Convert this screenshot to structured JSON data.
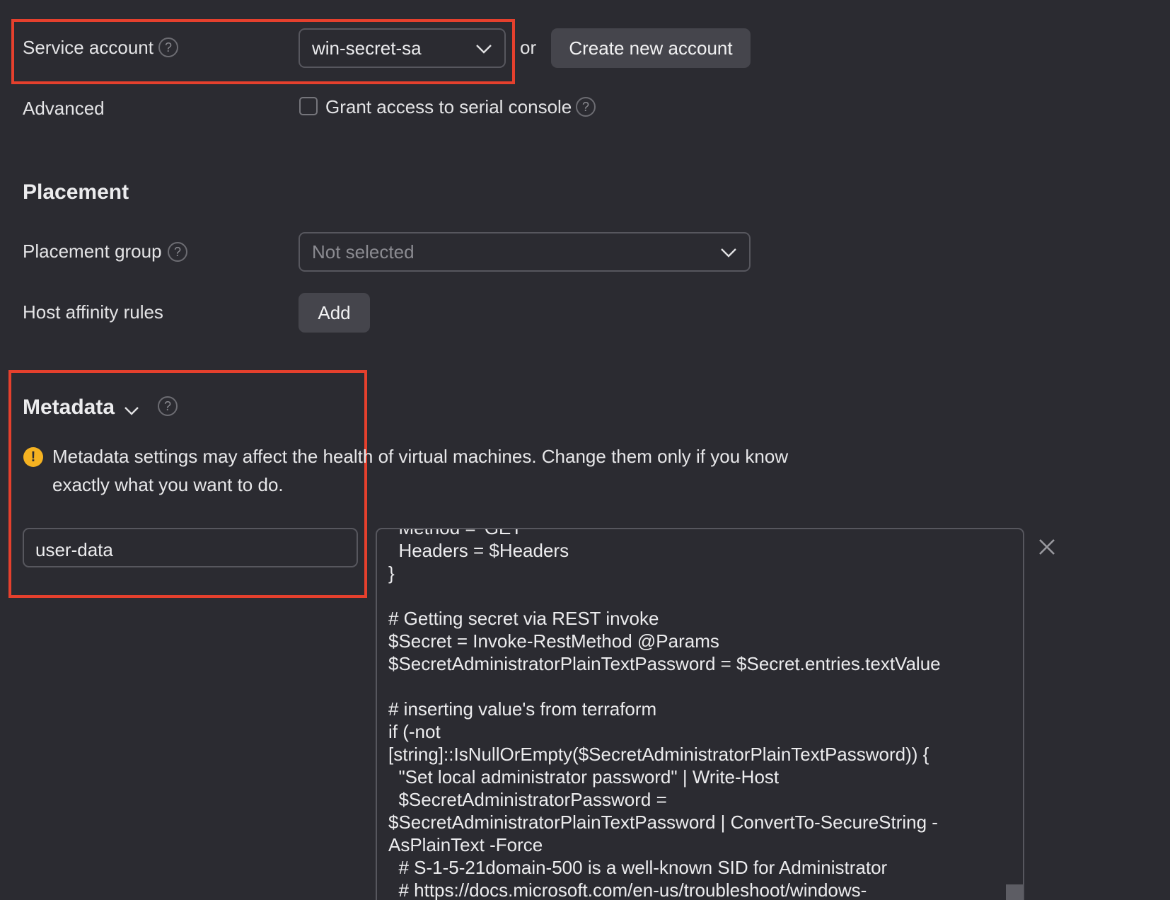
{
  "service_account": {
    "label": "Service account",
    "help": "?",
    "selected": "win-secret-sa",
    "or_text": "or",
    "create_button": "Create new account"
  },
  "advanced": {
    "label": "Advanced",
    "serial_console_label": "Grant access to serial console",
    "serial_console_checked": false,
    "help": "?"
  },
  "placement": {
    "title": "Placement",
    "group_label": "Placement group",
    "group_help": "?",
    "group_value": "Not selected",
    "affinity_label": "Host affinity rules",
    "add_button": "Add"
  },
  "metadata": {
    "title": "Metadata",
    "help": "?",
    "warning_icon": "!",
    "warning_line1": "Metadata settings may affect the health of virtual machines. Change them only if you know",
    "warning_line2": "exactly what you want to do.",
    "key": "user-data",
    "remove_icon": "×",
    "value_lines": [
      "  Method = 'GET'",
      "  Headers = $Headers",
      "}",
      "",
      "# Getting secret via REST invoke",
      "$Secret = Invoke-RestMethod @Params",
      "$SecretAdministratorPlainTextPassword = $Secret.entries.textValue",
      "",
      "# inserting value's from terraform",
      "if (-not",
      "[string]::IsNullOrEmpty($SecretAdministratorPlainTextPassword)) {",
      "  \"Set local administrator password\" | Write-Host",
      "  $SecretAdministratorPassword =",
      "$SecretAdministratorPlainTextPassword | ConvertTo-SecureString -",
      "AsPlainText -Force",
      "  # S-1-5-21domain-500 is a well-known SID for Administrator",
      "  # https://docs.microsoft.com/en-us/troubleshoot/windows-"
    ]
  },
  "colors": {
    "background": "#2b2b31",
    "highlight": "#e5402d",
    "warning": "#f5b221",
    "button": "#45454c"
  }
}
